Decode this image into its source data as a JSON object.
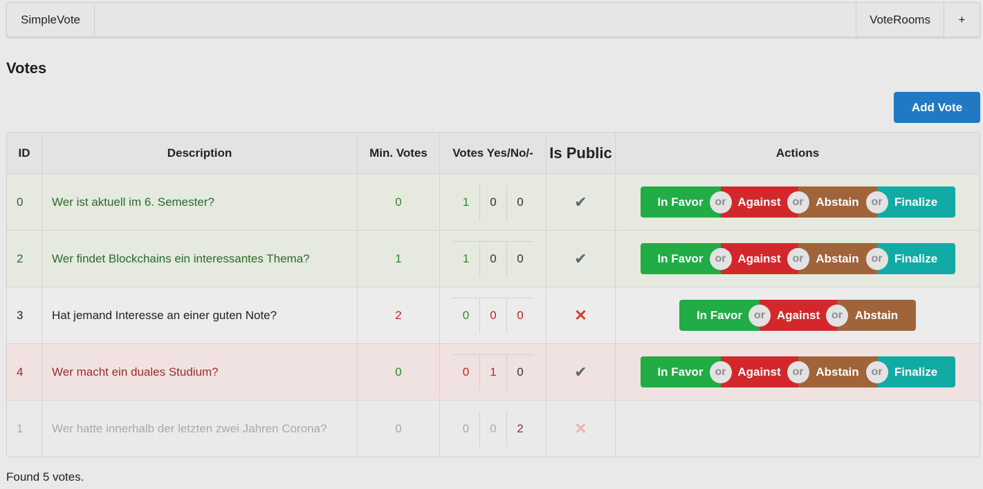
{
  "nav": {
    "brand": "SimpleVote",
    "rooms": "VoteRooms",
    "plus": "+"
  },
  "page_title": "Votes",
  "add_button": "Add Vote",
  "table": {
    "headers": [
      "ID",
      "Description",
      "Min. Votes",
      "Votes Yes/No/-",
      "Is Public",
      "Actions"
    ],
    "rows": [
      {
        "id": "0",
        "description": "Wer ist aktuell im 6. Semester?",
        "min_votes": "0",
        "yes": "1",
        "no": "0",
        "abstain": "0",
        "public": "✔"
      },
      {
        "id": "2",
        "description": "Wer findet Blockchains ein interessantes Thema?",
        "min_votes": "1",
        "yes": "1",
        "no": "0",
        "abstain": "0",
        "public": "✔"
      },
      {
        "id": "3",
        "description": "Hat jemand Interesse an einer guten Note?",
        "min_votes": "2",
        "yes": "0",
        "no": "0",
        "abstain": "0",
        "public": "✕"
      },
      {
        "id": "4",
        "description": "Wer macht ein duales Studium?",
        "min_votes": "0",
        "yes": "0",
        "no": "1",
        "abstain": "0",
        "public": "✔"
      },
      {
        "id": "1",
        "description": "Wer hatte innerhalb der letzten zwei Jahren Corona?",
        "min_votes": "0",
        "yes": "0",
        "no": "0",
        "abstain": "2",
        "public": "✕"
      }
    ]
  },
  "actions": {
    "favor": "In Favor",
    "against": "Against",
    "abstain": "Abstain",
    "finalize": "Finalize",
    "or": "or"
  },
  "footer": "Found 5 votes."
}
